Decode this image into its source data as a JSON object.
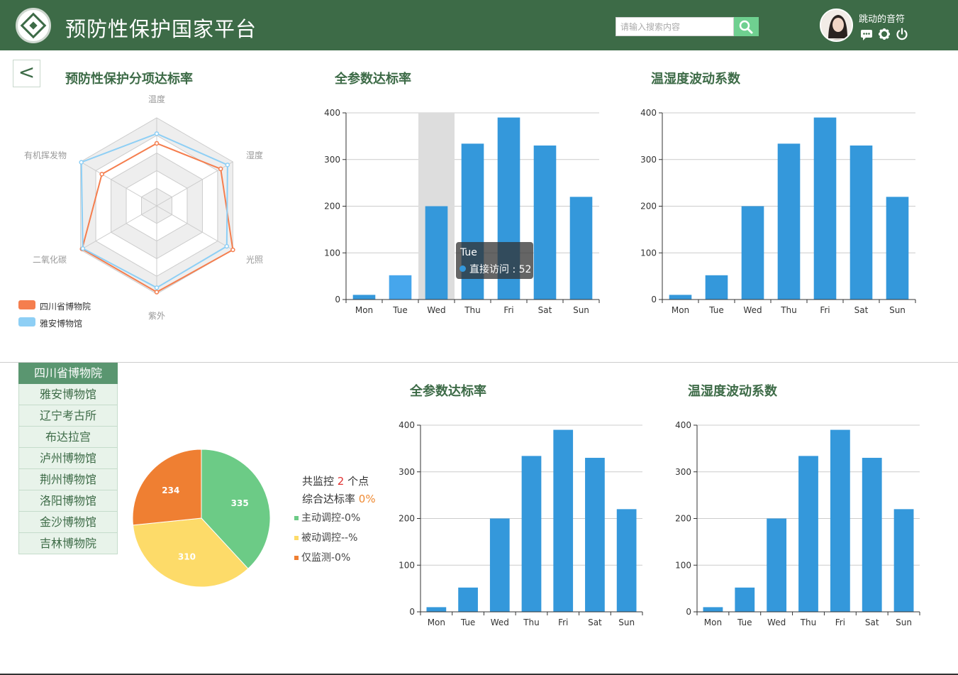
{
  "header": {
    "app_title": "预防性保护国家平台",
    "search_placeholder": "请输入搜索内容",
    "user_name": "跳动的音符"
  },
  "nav": {
    "back_label": "<"
  },
  "radar": {
    "title": "预防性保护分项达标率",
    "indicators": [
      "温度",
      "湿度",
      "光照",
      "紫外",
      "二氧化碳",
      "有机挥发物"
    ],
    "legend": [
      {
        "name": "四川省博物院",
        "color": "#f57e4e"
      },
      {
        "name": "雅安博物馆",
        "color": "#8ecff5"
      }
    ],
    "series_values": [
      [
        0.71,
        0.84,
        1.0,
        0.98,
        0.98,
        0.72
      ],
      [
        0.82,
        0.93,
        0.92,
        0.93,
        0.97,
        0.99
      ]
    ]
  },
  "top_charts": [
    {
      "title": "全参数达标率"
    },
    {
      "title": "温湿度波动系数"
    }
  ],
  "bottom_charts": [
    {
      "title": "全参数达标率"
    },
    {
      "title": "温湿度波动系数"
    }
  ],
  "tooltip": {
    "title": "Tue",
    "text": "直接访问 : 52"
  },
  "museums": {
    "items": [
      "四川省博物院",
      "雅安博物馆",
      "辽宁考古所",
      "布达拉宫",
      "泸州博物馆",
      "荆州博物馆",
      "洛阳博物馆",
      "金沙博物馆",
      "吉林博物院"
    ],
    "active_index": 0
  },
  "pie_stats": {
    "monitor_prefix": "共监控",
    "monitor_count": "2",
    "monitor_suffix": "个点",
    "rate_label": "综合达标率",
    "rate_value": "0%",
    "legend": [
      {
        "label": "主动调控-0%",
        "color": "#6ccb86"
      },
      {
        "label": "被动调控--%",
        "color": "#fddb69"
      },
      {
        "label": "仅监测-0%",
        "color": "#ef7f32"
      }
    ]
  },
  "chart_data": [
    {
      "type": "radar",
      "indicators": [
        "温度",
        "湿度",
        "光照",
        "紫外",
        "二氧化碳",
        "有机挥发物"
      ],
      "series": [
        {
          "name": "四川省博物院",
          "values": [
            0.71,
            0.84,
            1.0,
            0.98,
            0.98,
            0.72
          ]
        },
        {
          "name": "雅安博物馆",
          "values": [
            0.82,
            0.93,
            0.92,
            0.93,
            0.97,
            0.99
          ]
        }
      ],
      "colors": [
        "#f57e4e",
        "#8ecff5"
      ]
    },
    {
      "type": "bar",
      "categories": [
        "Mon",
        "Tue",
        "Wed",
        "Thu",
        "Fri",
        "Sat",
        "Sun"
      ],
      "values": [
        10,
        52,
        200,
        334,
        390,
        330,
        220
      ],
      "ylim": [
        0,
        400
      ],
      "yticks": [
        0,
        100,
        200,
        300,
        400
      ],
      "highlight_index": 1,
      "color": "#3498db"
    },
    {
      "type": "bar",
      "categories": [
        "Mon",
        "Tue",
        "Wed",
        "Thu",
        "Fri",
        "Sat",
        "Sun"
      ],
      "values": [
        10,
        52,
        200,
        334,
        390,
        330,
        220
      ],
      "ylim": [
        0,
        400
      ],
      "yticks": [
        0,
        100,
        200,
        300,
        400
      ],
      "color": "#3498db"
    },
    {
      "type": "pie",
      "slices": [
        {
          "label": "335",
          "value": 335,
          "color": "#6ccb86"
        },
        {
          "label": "310",
          "value": 310,
          "color": "#fddb69"
        },
        {
          "label": "234",
          "value": 234,
          "color": "#ef7f32"
        }
      ]
    },
    {
      "type": "bar",
      "categories": [
        "Mon",
        "Tue",
        "Wed",
        "Thu",
        "Fri",
        "Sat",
        "Sun"
      ],
      "values": [
        10,
        52,
        200,
        334,
        390,
        330,
        220
      ],
      "ylim": [
        0,
        400
      ],
      "yticks": [
        0,
        100,
        200,
        300,
        400
      ],
      "color": "#3498db"
    },
    {
      "type": "bar",
      "categories": [
        "Mon",
        "Tue",
        "Wed",
        "Thu",
        "Fri",
        "Sat",
        "Sun"
      ],
      "values": [
        10,
        52,
        200,
        334,
        390,
        330,
        220
      ],
      "ylim": [
        0,
        400
      ],
      "yticks": [
        0,
        100,
        200,
        300,
        400
      ],
      "color": "#3498db"
    }
  ]
}
